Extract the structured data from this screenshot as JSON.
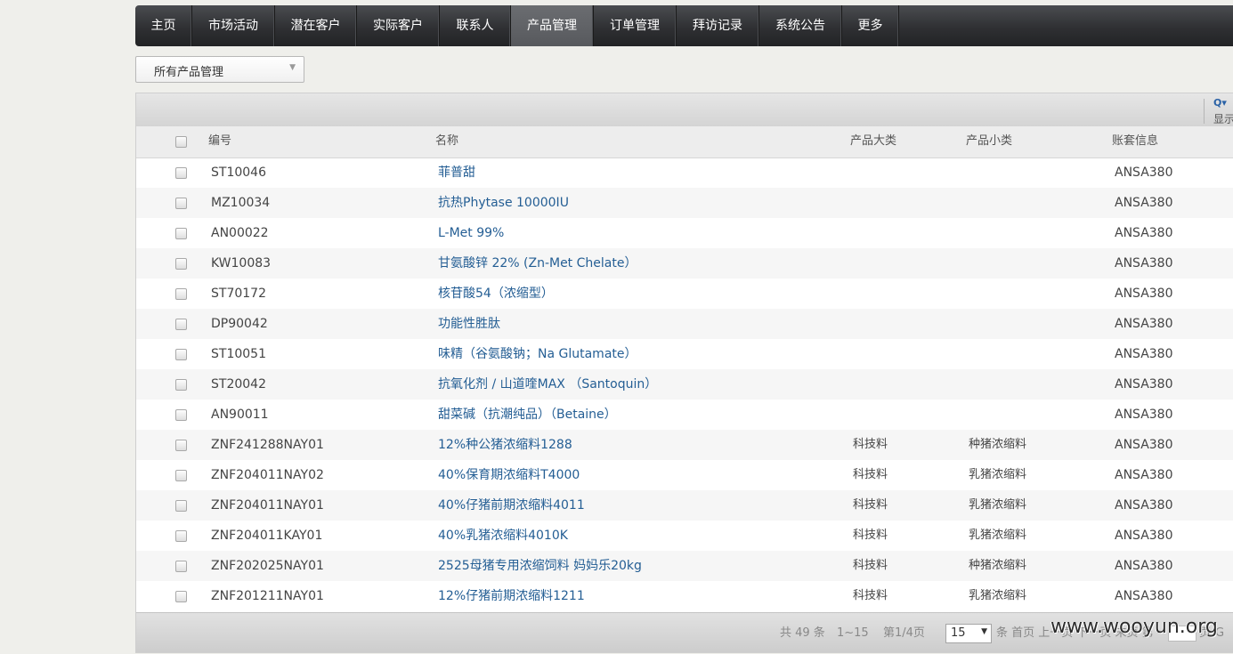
{
  "nav": {
    "items": [
      {
        "label": "主页",
        "active": false
      },
      {
        "label": "市场活动",
        "active": false
      },
      {
        "label": "潜在客户",
        "active": false
      },
      {
        "label": "实际客户",
        "active": false
      },
      {
        "label": "联系人",
        "active": false
      },
      {
        "label": "产品管理",
        "active": true
      },
      {
        "label": "订单管理",
        "active": false
      },
      {
        "label": "拜访记录",
        "active": false
      },
      {
        "label": "系统公告",
        "active": false
      },
      {
        "label": "更多",
        "active": false
      }
    ]
  },
  "view_select": {
    "value": "所有产品管理",
    "caret": "▼"
  },
  "toolbar": {
    "search_icon": "Q▾",
    "show_label": "显示"
  },
  "table": {
    "headers": {
      "code": "编号",
      "name": "名称",
      "major": "产品大类",
      "minor": "产品小类",
      "account": "账套信息"
    },
    "rows": [
      {
        "code": "ST10046",
        "name": "菲普甜",
        "major": "",
        "minor": "",
        "account": "ANSA380"
      },
      {
        "code": "MZ10034",
        "name": "抗热Phytase 10000IU",
        "major": "",
        "minor": "",
        "account": "ANSA380"
      },
      {
        "code": "AN00022",
        "name": "L-Met 99%",
        "major": "",
        "minor": "",
        "account": "ANSA380"
      },
      {
        "code": "KW10083",
        "name": "甘氨酸锌 22% (Zn-Met Chelate）",
        "major": "",
        "minor": "",
        "account": "ANSA380"
      },
      {
        "code": "ST70172",
        "name": "核苷酸54（浓缩型）",
        "major": "",
        "minor": "",
        "account": "ANSA380"
      },
      {
        "code": "DP90042",
        "name": "功能性胜肽",
        "major": "",
        "minor": "",
        "account": "ANSA380"
      },
      {
        "code": "ST10051",
        "name": "味精（谷氨酸钠；Na Glutamate）",
        "major": "",
        "minor": "",
        "account": "ANSA380"
      },
      {
        "code": "ST20042",
        "name": "抗氧化剂 / 山道喹MAX （Santoquin）",
        "major": "",
        "minor": "",
        "account": "ANSA380"
      },
      {
        "code": "AN90011",
        "name": "甜菜碱（抗潮纯品）（Betaine）",
        "major": "",
        "minor": "",
        "account": "ANSA380"
      },
      {
        "code": "ZNF241288NAY01",
        "name": "12%种公猪浓缩料1288",
        "major": "科技料",
        "minor": "种猪浓缩料",
        "account": "ANSA380"
      },
      {
        "code": "ZNF204011NAY02",
        "name": "40%保育期浓缩料T4000",
        "major": "科技料",
        "minor": "乳猪浓缩料",
        "account": "ANSA380"
      },
      {
        "code": "ZNF204011NAY01",
        "name": "40%仔猪前期浓缩料4011",
        "major": "科技料",
        "minor": "乳猪浓缩料",
        "account": "ANSA380"
      },
      {
        "code": "ZNF204011KAY01",
        "name": "40%乳猪浓缩料4010K",
        "major": "科技料",
        "minor": "乳猪浓缩料",
        "account": "ANSA380"
      },
      {
        "code": "ZNF202025NAY01",
        "name": "2525母猪专用浓缩饲料 妈妈乐20kg",
        "major": "科技料",
        "minor": "种猪浓缩料",
        "account": "ANSA380"
      },
      {
        "code": "ZNF201211NAY01",
        "name": "12%仔猪前期浓缩料1211",
        "major": "科技料",
        "minor": "乳猪浓缩料",
        "account": "ANSA380"
      }
    ]
  },
  "footer": {
    "total": "共 49 条",
    "range": "1~15",
    "page": "第1/4页",
    "page_size": "15",
    "page_size_caret": "▼",
    "links": "条 首页 上一页 下一页 末页 第",
    "page_unit": "页",
    "go_label": "G",
    "watermark": "www.wooyun.org"
  }
}
